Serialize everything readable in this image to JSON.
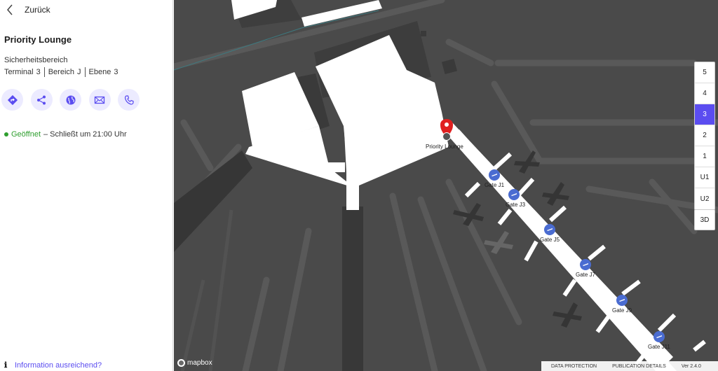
{
  "sidebar": {
    "back_label": "Zurück",
    "title": "Priority Lounge",
    "area": "Sicherheitsbereich",
    "location": [
      {
        "label": "Terminal",
        "value": "3"
      },
      {
        "label": "Bereich",
        "value": "J"
      },
      {
        "label": "Ebene",
        "value": "3"
      }
    ],
    "actions": [
      "directions-icon",
      "share-icon",
      "globe-icon",
      "mail-icon",
      "phone-icon"
    ],
    "status_open": "Geöffnet",
    "status_closes": "– Schließt um 21:00 Uhr",
    "info_link": "Information ausreichend?"
  },
  "map": {
    "poi_label": "Priority Lounge",
    "gates": [
      "Gate J1",
      "Gate J3",
      "Gate J5",
      "Gate J7",
      "Gate J9",
      "Gate J11"
    ],
    "floors": [
      "5",
      "4",
      "3",
      "2",
      "1",
      "U1",
      "U2"
    ],
    "active_floor": "3",
    "btn_3d": "3D",
    "mapbox": "mapbox",
    "colors": {
      "accent": "#5b4df0",
      "gate": "#4a6cd1",
      "pin": "#e02020",
      "open": "#2e9e2e"
    }
  },
  "footer": {
    "data_protection": "DATA PROTECTION",
    "publication": "PUBLICATION DETAILS",
    "version": "Ver 2.4.0"
  }
}
